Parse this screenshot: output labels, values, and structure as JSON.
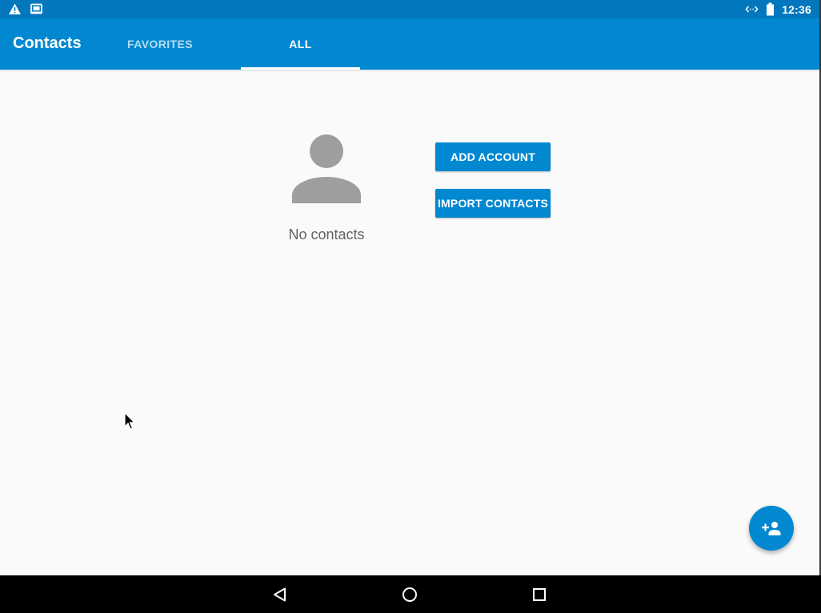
{
  "status_bar": {
    "time": "12:36",
    "left_icons": [
      "warning-icon",
      "screen-icon"
    ],
    "right_icons": [
      "data-sync-icon",
      "battery-icon"
    ]
  },
  "app_bar": {
    "title": "Contacts",
    "tabs": [
      {
        "label": "FAVORITES",
        "selected": false
      },
      {
        "label": "ALL",
        "selected": true
      }
    ]
  },
  "empty_state": {
    "icon": "person-icon",
    "message": "No contacts"
  },
  "actions": {
    "add_account_label": "ADD ACCOUNT",
    "import_contacts_label": "IMPORT CONTACTS"
  },
  "fab": {
    "icon": "add-person-icon"
  },
  "nav_bar": {
    "buttons": [
      "back-icon",
      "home-icon",
      "recents-icon"
    ]
  },
  "colors": {
    "status_bar": "#0277bd",
    "app_bar": "#0288d1",
    "accent": "#0288d1",
    "background": "#fafafa",
    "nav_bar": "#000000"
  }
}
